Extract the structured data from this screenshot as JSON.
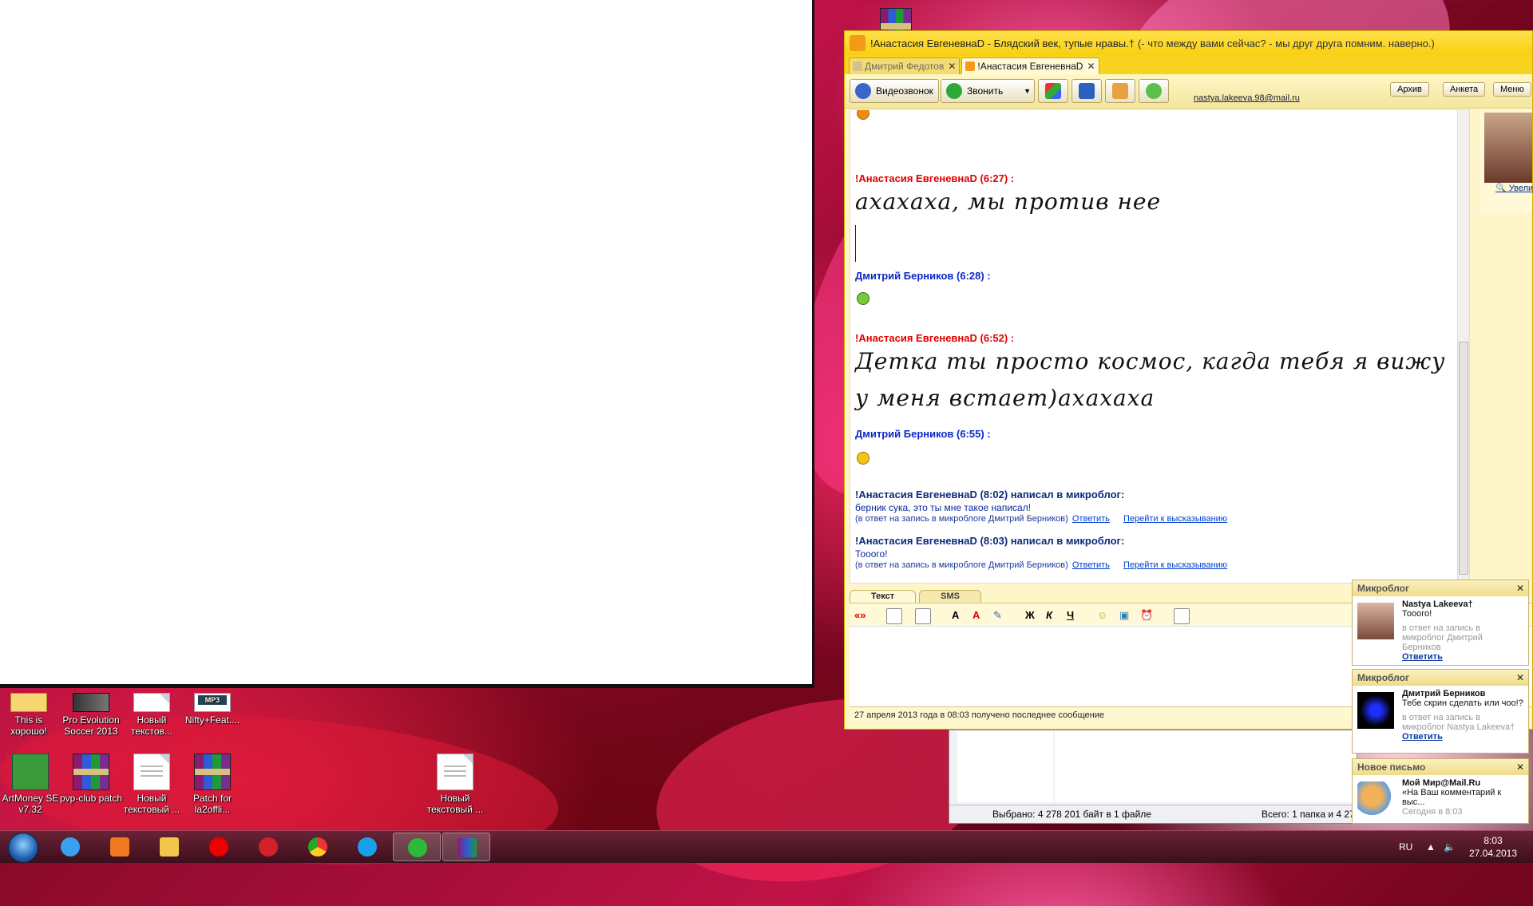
{
  "desktop": {
    "icons": [
      {
        "label": "This is хорошо!",
        "kind": "folder"
      },
      {
        "label": "Pro Evolution Soccer 2013",
        "kind": "app"
      },
      {
        "label": "Новый текстов...",
        "kind": "doc"
      },
      {
        "label": "Nifty+Feat....",
        "kind": "mp3",
        "badge": "MP3"
      },
      {
        "label": "ArtMoney SE v7.32",
        "kind": "money"
      },
      {
        "label": "pvp-club patch",
        "kind": "rar"
      },
      {
        "label": "Новый текстовый ...",
        "kind": "doc"
      },
      {
        "label": "Patch for la2offli...",
        "kind": "rar"
      },
      {
        "label": "Новый текстовый ...",
        "kind": "doc"
      }
    ]
  },
  "agent": {
    "title_name": "!Анастасия ЕвгеневнаD - Блядский век, тупые нравы.†",
    "title_status": "(- что между вами сейчас? - мы друг друга помним.  наверно.)",
    "tabs": [
      {
        "label": "Дмитрий Федотов",
        "active": false
      },
      {
        "label": "!Анастасия ЕвгеневнаD",
        "active": true
      }
    ],
    "toolbar": {
      "video_call": "Видеозвонок",
      "call": "Звонить",
      "archive": "Архив",
      "profile": "Анкета",
      "menu": "Меню"
    },
    "email": "nastya.lakeeva.98@mail.ru",
    "side_zoom": "Увели",
    "messages": [
      {
        "author": "!Анастасия ЕвгеневнаD (6:27) :",
        "who": "her",
        "text": "ахахаха, мы против нее"
      },
      {
        "author": "Дмитрий Берников (6:28) :",
        "who": "me",
        "smiley": "grin"
      },
      {
        "author": "!Анастасия ЕвгеневнаD (6:52) :",
        "who": "her",
        "line1": "Детка ты просто космос, кагда тебя я вижу",
        "line2": "у меня встает)ахахаха"
      },
      {
        "author": "Дмитрий Берников (6:55) :",
        "who": "me",
        "smiley": "smile"
      }
    ],
    "microblog": [
      {
        "head": "!Анастасия ЕвгеневнаD (8:02) написал в микроблог:",
        "text": "берник сука, это ты мне такое написал!",
        "ref": "(в ответ на запись в микроблоге Дмитрий Берников)",
        "reply": "Ответить",
        "goto": "Перейти к высказыванию"
      },
      {
        "head": "!Анастасия ЕвгеневнаD (8:03) написал в микроблог:",
        "text": "Тооого!",
        "ref": "(в ответ на запись в микроблоге Дмитрий Берников)",
        "reply": "Ответить",
        "goto": "Перейти к высказыванию"
      }
    ],
    "input_tabs": {
      "text": "Текст",
      "sms": "SMS"
    },
    "format": {
      "quote": "«»",
      "bold": "Ж",
      "italic": "К",
      "underline": "Ч"
    },
    "status_line": "27 апреля 2013 года в 08:03 получено последнее сообщение"
  },
  "explorer": {
    "selected": "Выбрано: 4 278 201 байт в 1 файле",
    "total": "Всего: 1 папка и 4 27"
  },
  "notifications": [
    {
      "header": "Микроблог",
      "title": "Nastya Lakeeva†",
      "text": "Тооого!",
      "ref": "в ответ на запись в микроблог Дмитрий Берников",
      "action": "Ответить"
    },
    {
      "header": "Микроблог",
      "title": "Дмитрий Берников",
      "text": "Тебе скрин сделать или чоо!?",
      "ref": "в ответ на запись в микроблог Nastya Lakeeva†",
      "action": "Ответить"
    },
    {
      "header": "Новое письмо",
      "title": "Мой Мир@Mail.Ru",
      "text": "«На Ваш комментарий к выс...",
      "ref": "Сегодня в 8:03",
      "action": ""
    }
  ],
  "taskbar": {
    "lang": "RU",
    "time": "8:03",
    "date": "27.04.2013"
  },
  "colors": {
    "her": "#e00000",
    "me": "#0a28c8",
    "agent_yellow": "#f8cf10"
  }
}
